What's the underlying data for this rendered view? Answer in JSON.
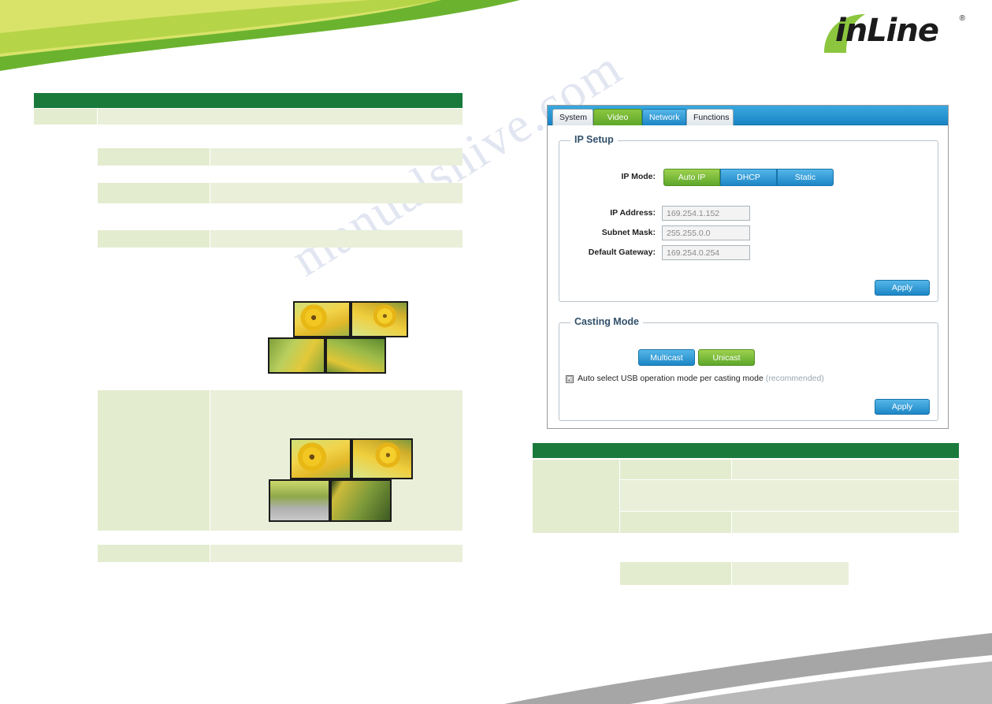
{
  "page": {
    "brand": "inLine",
    "brand_reg": "®",
    "watermark": "manualshive.com",
    "watermark_top": ""
  },
  "gui": {
    "tabs": [
      {
        "label": "System",
        "state": "inactive"
      },
      {
        "label": "Video Wall",
        "state": "green"
      },
      {
        "label": "Network",
        "state": "blue"
      },
      {
        "label": "Functions",
        "state": "inactive"
      }
    ],
    "ip_setup": {
      "title": "IP Setup",
      "mode_label": "IP Mode:",
      "modes": [
        {
          "label": "Auto IP",
          "selected": true
        },
        {
          "label": "DHCP",
          "selected": false
        },
        {
          "label": "Static",
          "selected": false
        }
      ],
      "fields": [
        {
          "label": "IP Address:",
          "value": "169.254.1.152"
        },
        {
          "label": "Subnet Mask:",
          "value": "255.255.0.0"
        },
        {
          "label": "Default Gateway:",
          "value": "169.254.0.254"
        }
      ],
      "apply_label": "Apply"
    },
    "casting_mode": {
      "title": "Casting Mode",
      "buttons": [
        {
          "label": "Multicast",
          "selected": false
        },
        {
          "label": "Unicast",
          "selected": true
        }
      ],
      "checkbox": {
        "checked": true,
        "mark": "☑",
        "label": "Auto select USB operation mode per casting mode",
        "hint": "(recommended)"
      },
      "apply_label": "Apply"
    }
  },
  "left_tables": {
    "table1_header": "",
    "rows": [
      {
        "label": "",
        "value": ""
      },
      {
        "label": "",
        "value": ""
      },
      {
        "label": "",
        "value": ""
      },
      {
        "label": "",
        "value": ""
      },
      {
        "label": "",
        "value": ""
      },
      {
        "label": "",
        "value": ""
      }
    ]
  },
  "right_tables": {
    "header": "",
    "rows": [
      {
        "c1": "",
        "c2": "",
        "c3": ""
      },
      {
        "c1": "",
        "c2": "",
        "c3": ""
      },
      {
        "c1": "",
        "c2": "",
        "c3": ""
      },
      {
        "c1": "",
        "c2": "",
        "c3": ""
      }
    ]
  }
}
